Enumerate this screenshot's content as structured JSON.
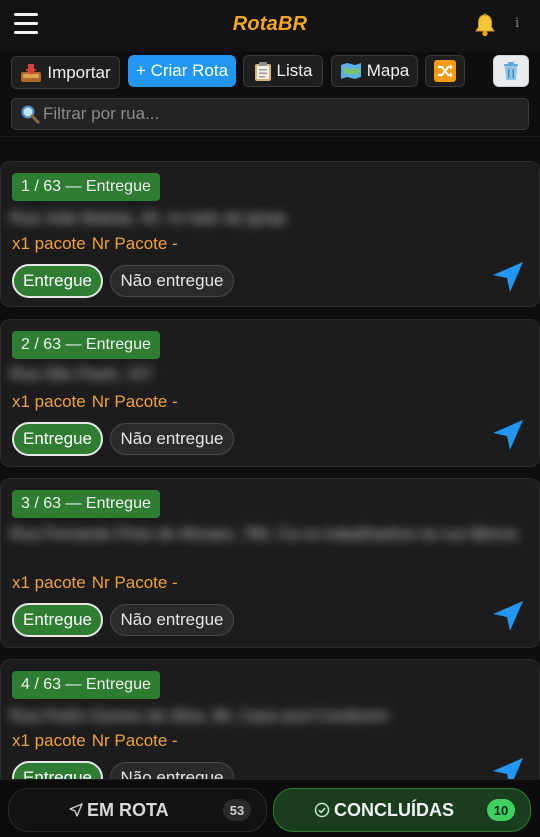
{
  "app": {
    "title": "RotaBR"
  },
  "header": {
    "info_label": "i"
  },
  "toolbar": {
    "import_label": "Importar",
    "create_label": "+ Criar Rota",
    "list_label": "Lista",
    "map_label": "Mapa"
  },
  "search": {
    "placeholder": "Filtrar por rua..."
  },
  "cards": [
    {
      "badge": "1 / 63 — Entregue",
      "address": "Rua João Batista, 45, no lado da igreja",
      "quantity": "x1 pacote",
      "package": "Nr Pacote -",
      "delivered_label": "Entregue",
      "not_delivered_label": "Não entregue"
    },
    {
      "badge": "2 / 63 — Entregue",
      "address": "Rua São Paulo, 157",
      "quantity": "x1 pacote",
      "package": "Nr Pacote -",
      "delivered_label": "Entregue",
      "not_delivered_label": "Não entregue"
    },
    {
      "badge": "3 / 63 — Entregue",
      "address": "Rua Fernando Pinto de Moraes, 780, Ca no trabalhadora na rua fábrica",
      "quantity": "x1 pacote",
      "package": "Nr Pacote -",
      "delivered_label": "Entregue",
      "not_delivered_label": "Não entregue"
    },
    {
      "badge": "4 / 63 — Entregue",
      "address": "Rua Pedro Gomes da Silva, 86, Casa azul Condomín",
      "quantity": "x1 pacote",
      "package": "Nr Pacote -",
      "delivered_label": "Entregue",
      "not_delivered_label": "Não entregue"
    }
  ],
  "bottom": {
    "route_label": "EM ROTA",
    "route_count": "53",
    "done_label": "CONCLUÍDAS",
    "done_count": "10"
  },
  "colors": {
    "accent_title": "#f5a623",
    "primary_button": "#2196f3",
    "delivered_green": "#2e7d32",
    "package_orange": "#f0a040",
    "navigate_blue": "#2196f3"
  },
  "icons": [
    "menu-icon",
    "bell-icon",
    "inbox-tray-icon",
    "clipboard-icon",
    "map-icon",
    "shuffle-icon",
    "trash-icon",
    "magnifier-icon",
    "navigate-arrow-icon",
    "send-icon",
    "check-circle-icon"
  ]
}
